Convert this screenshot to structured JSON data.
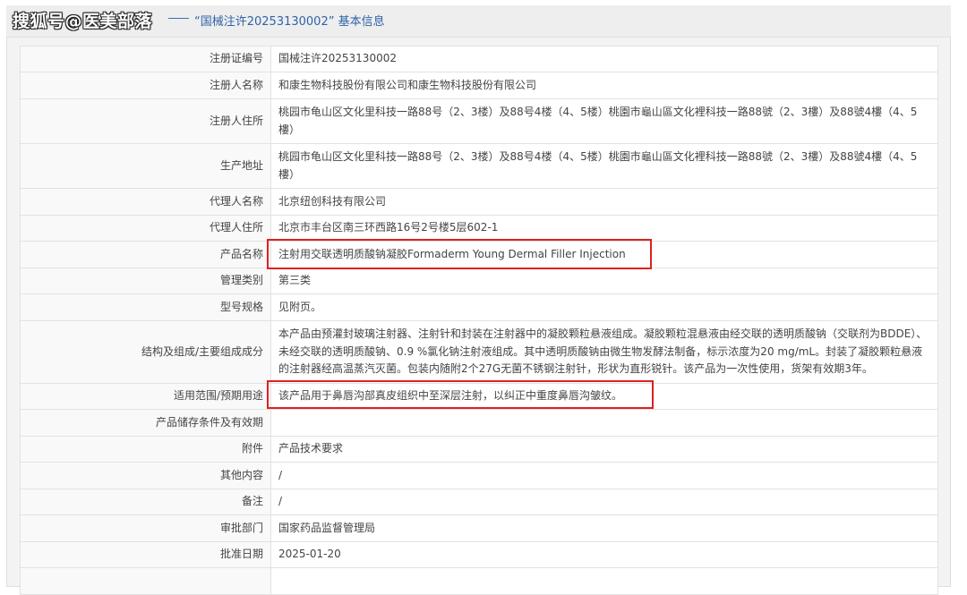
{
  "header": {
    "watermark": "搜狐号@医美部落",
    "title": "“国械注许20253130002” 基本信息"
  },
  "rows": [
    {
      "label": "注册证编号",
      "value": "国械注许20253130002"
    },
    {
      "label": "注册人名称",
      "value": "和康生物科技股份有限公司和康生物科技股份有限公司"
    },
    {
      "label": "注册人住所",
      "value": "桃园市龟山区文化里科技一路88号（2、3楼）及88号4楼（4、5楼）桃園市龜山區文化裡科技一路88號（2、3樓）及88號4樓（4、5樓）"
    },
    {
      "label": "生产地址",
      "value": "桃园市龟山区文化里科技一路88号（2、3楼）及88号4楼（4、5楼）桃園市龜山區文化裡科技一路88號（2、3樓）及88號4樓（4、5樓）"
    },
    {
      "label": "代理人名称",
      "value": "北京纽创科技有限公司"
    },
    {
      "label": "代理人住所",
      "value": "北京市丰台区南三环西路16号2号楼5层602-1"
    },
    {
      "label": "产品名称",
      "value": "注射用交联透明质酸钠凝胶Formaderm Young Dermal Filler Injection"
    },
    {
      "label": "管理类别",
      "value": "第三类"
    },
    {
      "label": "型号规格",
      "value": "见附页。"
    },
    {
      "label": "结构及组成/主要组成成分",
      "value": "本产品由预灌封玻璃注射器、注射针和封装在注射器中的凝胶颗粒悬液组成。凝胶颗粒混悬液由经交联的透明质酸钠（交联剂为BDDE）、未经交联的透明质酸钠、0.9 %氯化钠注射液组成。其中透明质酸钠由微生物发酵法制备，标示浓度为20 mg/mL。封装了凝胶颗粒悬液的注射器经高温蒸汽灭菌。包装内随附2个27G无菌不锈钢注射针，形状为直形锐针。该产品为一次性使用，货架有效期3年。"
    },
    {
      "label": "适用范围/预期用途",
      "value": "该产品用于鼻唇沟部真皮组织中至深层注射，以纠正中重度鼻唇沟皱纹。"
    },
    {
      "label": "产品储存条件及有效期",
      "value": ""
    },
    {
      "label": "附件",
      "value": "产品技术要求"
    },
    {
      "label": "其他内容",
      "value": "/"
    },
    {
      "label": "备注",
      "value": "/"
    },
    {
      "label": "审批部门",
      "value": "国家药品监督管理局"
    },
    {
      "label": "批准日期",
      "value": "2025-01-20"
    },
    {
      "label": "",
      "value": ""
    }
  ],
  "highlight_color": "#e02020"
}
